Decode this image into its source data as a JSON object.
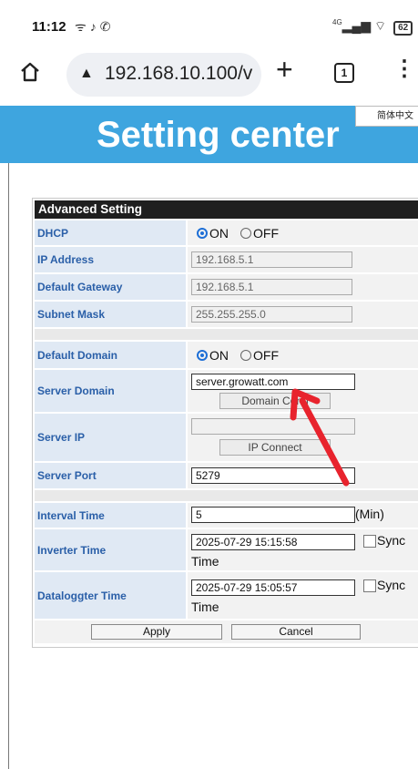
{
  "status_bar": {
    "time": "11:12",
    "icons": [
      "wifi-calling-icon",
      "tiktok-icon",
      "whatsapp-icon"
    ],
    "signal": "4G",
    "battery": "62"
  },
  "browser": {
    "url": "192.168.10.100/v",
    "tab_count": "1"
  },
  "banner": {
    "title": "Setting center",
    "language_button": "简体中文",
    "color": "#3ea5df"
  },
  "panel": {
    "header": "Advanced Setting",
    "dhcp": {
      "label": "DHCP",
      "on": "ON",
      "off": "OFF",
      "selected": "ON"
    },
    "ip_address": {
      "label": "IP Address",
      "value": "192.168.5.1"
    },
    "default_gateway": {
      "label": "Default Gateway",
      "value": "192.168.5.1"
    },
    "subnet_mask": {
      "label": "Subnet Mask",
      "value": "255.255.255.0"
    },
    "default_domain": {
      "label": "Default Domain",
      "on": "ON",
      "off": "OFF",
      "selected": "ON"
    },
    "server_domain": {
      "label": "Server Domain",
      "value": "server.growatt.com",
      "button": "Domain Conn"
    },
    "server_ip": {
      "label": "Server IP",
      "value": "",
      "button": "IP Connect"
    },
    "server_port": {
      "label": "Server Port",
      "value": "5279"
    },
    "interval_time": {
      "label": "Interval Time",
      "value": "5",
      "unit": "(Min)"
    },
    "inverter_time": {
      "label": "Inverter Time",
      "value": "2025-07-29 15:15:58",
      "sync": "Sync",
      "sync_time": "Time"
    },
    "datalogger_time": {
      "label": "Dataloggter Time",
      "value": "2025-07-29 15:05:57",
      "sync": "Sync",
      "sync_time": "Time"
    },
    "apply": "Apply",
    "cancel": "Cancel"
  },
  "annotation": {
    "color": "#e8232d"
  }
}
